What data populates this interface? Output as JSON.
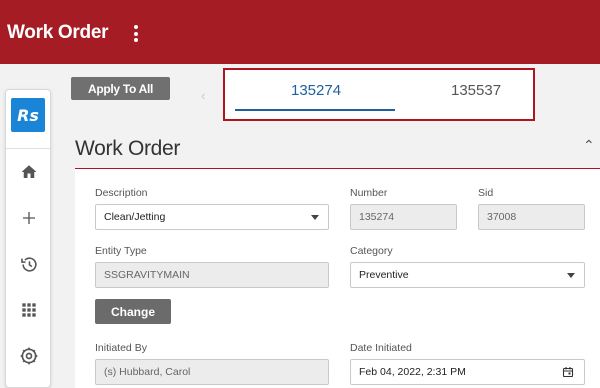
{
  "header": {
    "title": "Work Order"
  },
  "toolbar": {
    "apply_label": "Apply To All"
  },
  "tabs": [
    {
      "label": "135274",
      "active": true
    },
    {
      "label": "135537",
      "active": false
    }
  ],
  "sidebar": {
    "logo": "Rs",
    "items": [
      "home-icon",
      "add-icon",
      "history-icon",
      "apps-icon",
      "settings-icon"
    ]
  },
  "section": {
    "title": "Work Order"
  },
  "form": {
    "description": {
      "label": "Description",
      "value": "Clean/Jetting"
    },
    "number": {
      "label": "Number",
      "value": "135274"
    },
    "sid": {
      "label": "Sid",
      "value": "37008"
    },
    "entity_type": {
      "label": "Entity Type",
      "value": "SSGRAVITYMAIN"
    },
    "category": {
      "label": "Category",
      "value": "Preventive"
    },
    "change_label": "Change",
    "initiated_by": {
      "label": "Initiated By",
      "value": "(s) Hubbard, Carol"
    },
    "date_initiated": {
      "label": "Date Initiated",
      "value": "Feb 04, 2022, 2:31 PM"
    }
  },
  "colors": {
    "brand": "#a51c24",
    "accent": "#1f5f9f",
    "logo": "#1a85d6"
  }
}
